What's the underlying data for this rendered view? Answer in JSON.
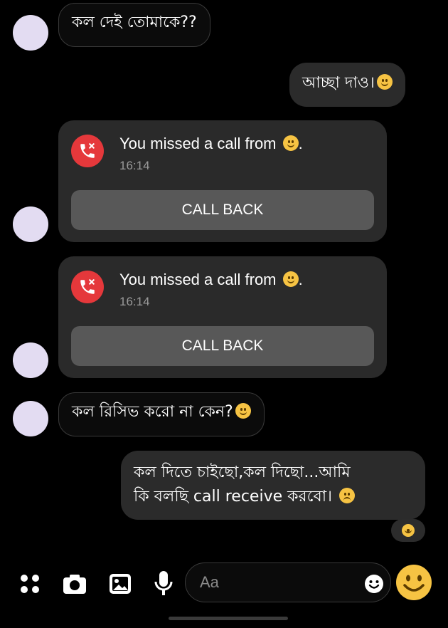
{
  "messages": [
    {
      "id": "m1",
      "direction": "incoming",
      "text": "কল দেই তোমাকে??"
    },
    {
      "id": "m2",
      "direction": "outgoing",
      "text": "আচ্ছা দাও।",
      "emoji": "smile"
    },
    {
      "id": "m3",
      "direction": "incoming",
      "type": "missed_call",
      "title": "You missed a call from",
      "emoji": "smile",
      "time": "16:14",
      "action": "CALL BACK"
    },
    {
      "id": "m4",
      "direction": "incoming",
      "type": "missed_call",
      "title": "You missed a call from",
      "emoji": "smile",
      "time": "16:14",
      "action": "CALL BACK"
    },
    {
      "id": "m5",
      "direction": "incoming",
      "text": "কল রিসিভ করো না কেন?",
      "emoji": "smile"
    },
    {
      "id": "m6",
      "direction": "outgoing",
      "lines": [
        "কল দিতে চাইছো,কল দিছো...আমি",
        "কি বলছি call receive করবো।"
      ],
      "emoji": "sad",
      "reaction": "smile"
    }
  ],
  "composer": {
    "placeholder": "Aa",
    "icons": [
      "menu-dots-icon",
      "camera-icon",
      "gallery-icon",
      "mic-icon",
      "emoji-icon",
      "like-emoji-icon"
    ]
  },
  "colors": {
    "background": "#000000",
    "incoming_border": "#3a3a3a",
    "outgoing_bg": "#2b2b2b",
    "card_bg": "#2a2a2a",
    "call_button_bg": "#585858",
    "missed_call_red": "#e5383b",
    "avatar": "#e3dcf2",
    "emoji": "#f6c343"
  }
}
